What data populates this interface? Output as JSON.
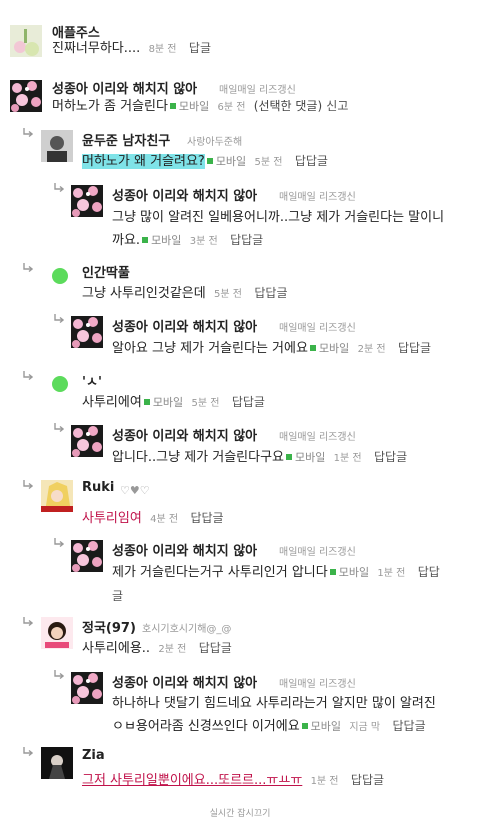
{
  "comments": [
    {
      "nick": "애플주스",
      "text": "진짜너무하다....",
      "time": "8분 전",
      "reply": "답글"
    },
    {
      "nick": "성종아 이리와 해치지 않아",
      "sub": "매일매일 리즈갱신",
      "text": "머하노가 좀 거슬린다",
      "mobile": "모바일",
      "time": "6분 전",
      "extra": "(선택한 댓글)",
      "extra2": "신고"
    },
    {
      "nick": "윤두준 남자친구",
      "sub": "사랑아두준해",
      "text": "머하노가 왜 거슬려요?",
      "mobile": "모바일",
      "time": "5분 전",
      "reply": "답답글"
    },
    {
      "nick": "성종아 이리와 해치지 않아",
      "sub": "매일매일 리즈갱신",
      "text1": "그냥 많이 알려진 일베용어니까..그냥 제가 거슬린다는 말이니",
      "text2": "까요.",
      "mobile": "모바일",
      "time": "3분 전",
      "reply": "답답글"
    },
    {
      "nick": "인간딱풀",
      "text": "그냥 사투리인것같은데",
      "time": "5분 전",
      "reply": "답답글"
    },
    {
      "nick": "성종아 이리와 해치지 않아",
      "sub": "매일매일 리즈갱신",
      "text": "알아요 그냥 제가 거슬린다는 거에요",
      "mobile": "모바일",
      "time": "2분 전",
      "reply": "답답글"
    },
    {
      "nick": "'ㅅ'",
      "text": "사투리에여",
      "mobile": "모바일",
      "time": "5분 전",
      "reply": "답답글"
    },
    {
      "nick": "성종아 이리와 해치지 않아",
      "sub": "매일매일 리즈갱신",
      "text": "압니다..그냥 제가 거슬린다구요",
      "mobile": "모바일",
      "time": "1분 전",
      "reply": "답답글"
    },
    {
      "nick": "Ruki",
      "sub": "♡♥♡",
      "text": "사투리임여",
      "time": "4분 전",
      "reply": "답답글"
    },
    {
      "nick": "성종아 이리와 해치지 않아",
      "sub": "매일매일 리즈갱신",
      "text1": "제가 거슬린다는거구 사투리인거 압니다",
      "text2": "글",
      "mobile": "모바일",
      "time": "1분 전",
      "reply": "답답"
    },
    {
      "nick": "정국(97)",
      "sub": "호시기호시기해@_@",
      "text": "사투리에용..",
      "time": "2분 전",
      "reply": "답답글"
    },
    {
      "nick": "성종아 이리와 해치지 않아",
      "sub": "매일매일 리즈갱신",
      "text1": "하나하나 댓달기 힘드네요 사투리라는거 알지만 많이 알려진",
      "text2": "ㅇㅂ용어라좀 신경쓰인다 이거에요",
      "mobile": "모바일",
      "time": "지금 막",
      "reply": "답답글"
    },
    {
      "nick": "Zia",
      "text": "그저 사투리일뿐이에요...또르르...ㅠㅛㅠ",
      "time": "1분 전",
      "reply": "답답글"
    }
  ],
  "footer": "실시간 잡시끄기"
}
